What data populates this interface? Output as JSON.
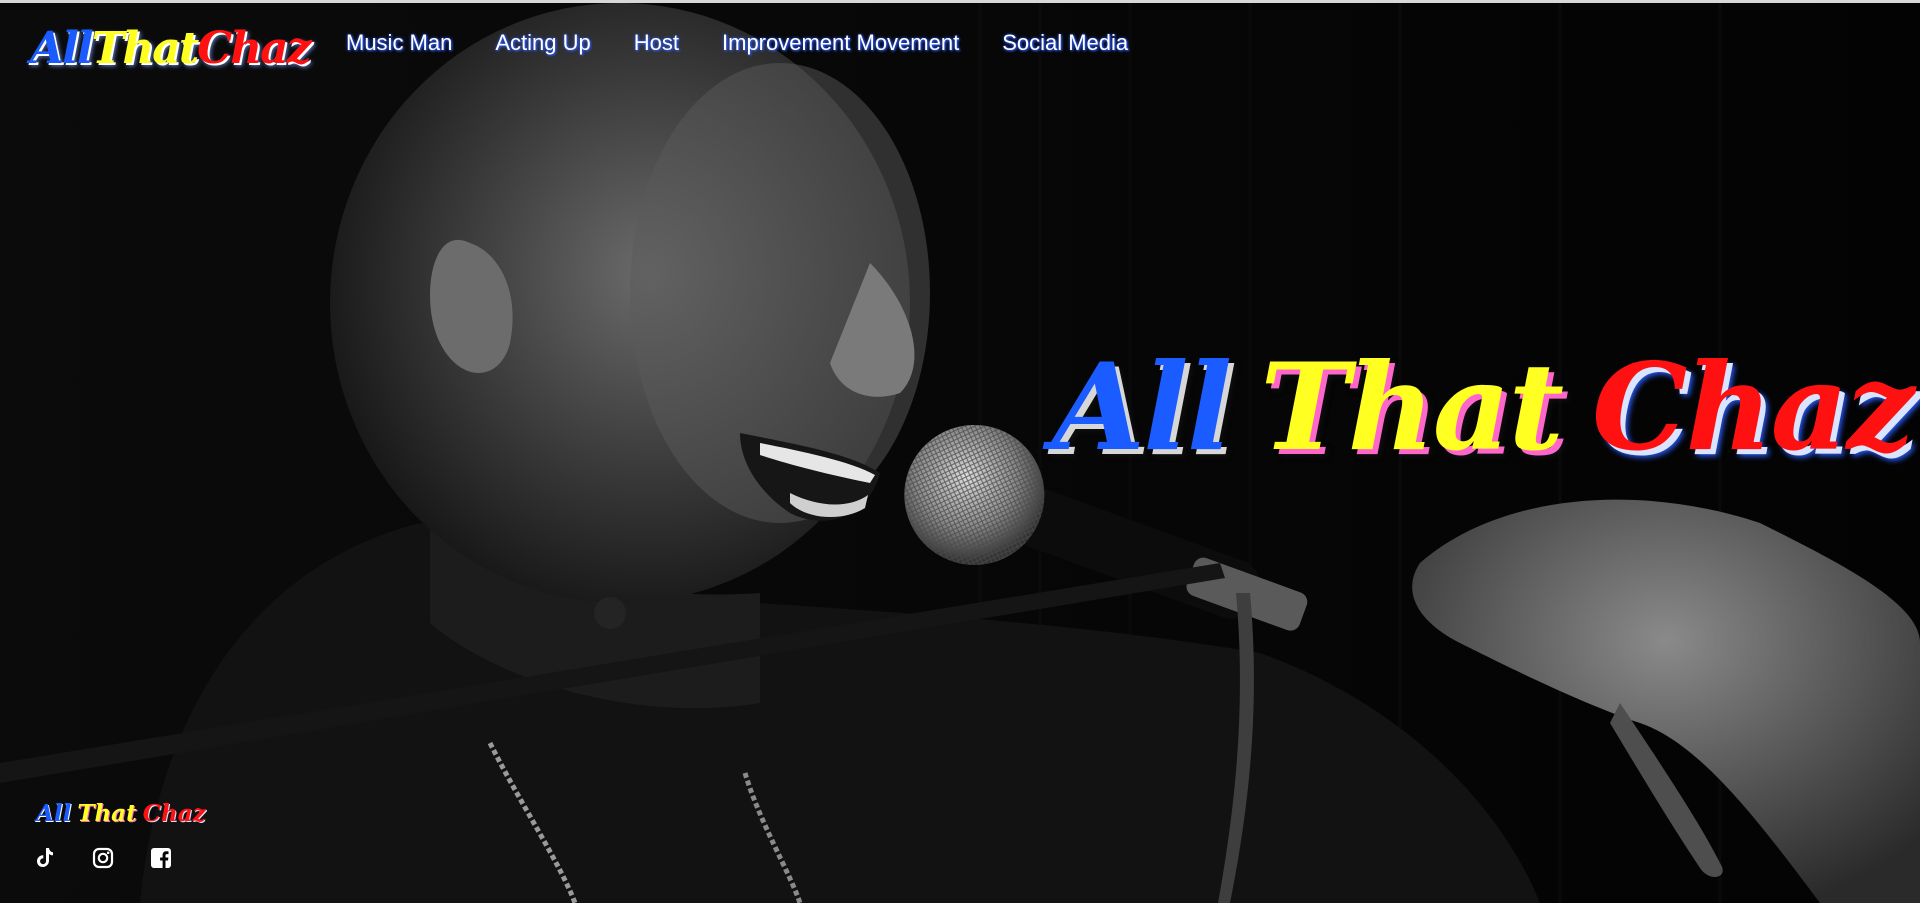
{
  "brand": {
    "logo_words": [
      "All",
      "That",
      "Chaz"
    ],
    "colors": {
      "blue": "#1a5cff",
      "yellow": "#ffff22",
      "red": "#ff1111"
    }
  },
  "nav": {
    "items": [
      {
        "label": "Music Man"
      },
      {
        "label": "Acting Up"
      },
      {
        "label": "Host"
      },
      {
        "label": "Improvement Movement"
      },
      {
        "label": "Social Media"
      }
    ]
  },
  "hero": {
    "headline_words": [
      "All",
      "That",
      "Chaz"
    ],
    "image": "black-and-white photo of laughing performer singing into a microphone"
  },
  "footer": {
    "logo_words": [
      "All",
      "That",
      "Chaz"
    ],
    "socials": [
      {
        "icon": "tiktok-icon"
      },
      {
        "icon": "instagram-icon"
      },
      {
        "icon": "facebook-icon"
      }
    ]
  }
}
